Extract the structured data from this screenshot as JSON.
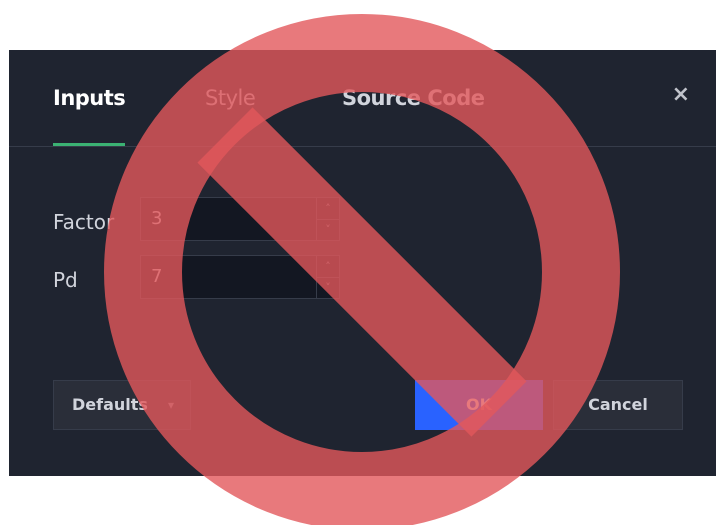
{
  "dialog": {
    "tabs": [
      {
        "label": "Inputs",
        "active": true
      },
      {
        "label": "Style",
        "active": false
      },
      {
        "label": "Source Code",
        "active": false
      }
    ],
    "close_label": "×"
  },
  "inputs": [
    {
      "label": "Factor",
      "value": "3"
    },
    {
      "label": "Pd",
      "value": "7"
    }
  ],
  "stepper": {
    "up": "˄",
    "down": "˅"
  },
  "buttons": {
    "defaults_label": "Defaults",
    "defaults_caret": "▾",
    "ok_label": "OK",
    "cancel_label": "Cancel"
  },
  "colors": {
    "dialog_bg": "#1f2430",
    "input_bg": "#131722",
    "active_tab_underline": "#3bb273",
    "ok_button": "#2962ff",
    "prohibition_overlay": "#e2575b"
  },
  "overlay": {
    "icon": "prohibition-sign"
  }
}
